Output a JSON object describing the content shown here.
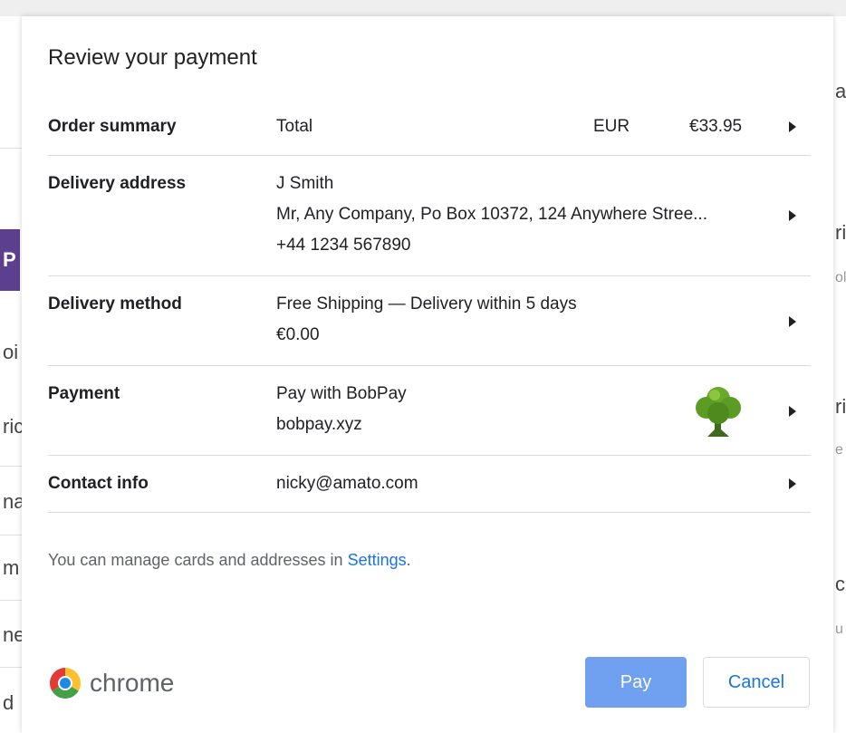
{
  "dialog": {
    "title": "Review your payment",
    "rows": {
      "order": {
        "label": "Order summary",
        "total_label": "Total",
        "currency": "EUR",
        "amount": "€33.95"
      },
      "address": {
        "label": "Delivery address",
        "name": "J Smith",
        "line": "Mr, Any Company, Po Box 10372, 124 Anywhere Stree...",
        "phone": "+44 1234 567890"
      },
      "method": {
        "label": "Delivery method",
        "name": "Free Shipping — Delivery within 5 days",
        "price": "€0.00"
      },
      "payment": {
        "label": "Payment",
        "name": "Pay with BobPay",
        "domain": "bobpay.xyz",
        "icon": "tree-icon"
      },
      "contact": {
        "label": "Contact info",
        "email": "nicky@amato.com"
      }
    },
    "note": {
      "prefix": "You can manage cards and addresses in ",
      "link": "Settings",
      "suffix": "."
    },
    "brand": "chrome",
    "pay_button": "Pay",
    "cancel_button": "Cancel"
  },
  "background_fragments": {
    "left": [
      "P",
      "oi",
      "ric",
      "na",
      "m",
      "ne",
      "d"
    ],
    "right": [
      "a",
      "ri",
      "ol",
      "ri",
      "e",
      "c",
      "u"
    ]
  },
  "colors": {
    "link": "#1a73e8",
    "pay_button": "#6fa1f0",
    "purple_tab": "#5c3f8f"
  }
}
